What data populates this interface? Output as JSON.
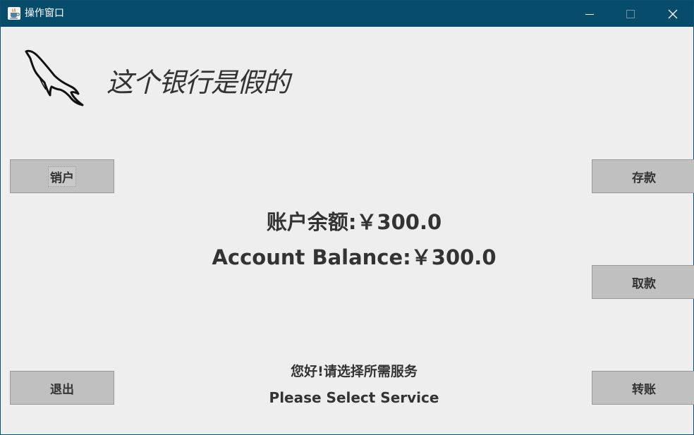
{
  "window": {
    "title": "操作窗口",
    "app_icon": "java-cup-icon",
    "controls": {
      "minimize": "minimize-icon",
      "maximize": "maximize-icon",
      "close": "close-icon"
    }
  },
  "header": {
    "logo_icon": "dolphin-logo-icon",
    "slogan": "这个银行是假的"
  },
  "buttons": {
    "close_account": "销户",
    "exit": "退出",
    "deposit": "存款",
    "withdraw": "取款",
    "transfer": "转账"
  },
  "balance": {
    "cn": "账户余额:￥300.0",
    "en": "Account Balance:￥300.0"
  },
  "prompt": {
    "cn": "您好!请选择所需服务",
    "en": "Please Select Service"
  },
  "colors": {
    "titlebar": "#084c6c",
    "background": "#eeeeee",
    "button": "#c0c0c0",
    "text": "#333333"
  }
}
